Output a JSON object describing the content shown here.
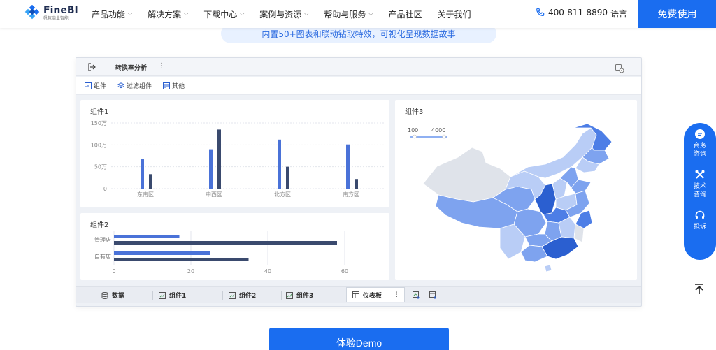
{
  "nav": {
    "logo_name": "FineBI",
    "logo_sub": "帆软商业智能",
    "menu": [
      {
        "label": "产品功能",
        "has_dropdown": true
      },
      {
        "label": "解决方案",
        "has_dropdown": true
      },
      {
        "label": "下载中心",
        "has_dropdown": true
      },
      {
        "label": "案例与资源",
        "has_dropdown": true
      },
      {
        "label": "帮助与服务",
        "has_dropdown": true
      },
      {
        "label": "产品社区",
        "has_dropdown": false
      },
      {
        "label": "关于我们",
        "has_dropdown": false
      }
    ],
    "phone": "400-811-8890",
    "language": "语言",
    "free_button": "免费使用"
  },
  "subtitle": "内置50+图表和联动钻取特效，可视化呈现数据故事",
  "dashboard": {
    "title": "转换率分析",
    "more": "⋮",
    "tools": [
      "组件",
      "过滤组件",
      "其他"
    ],
    "bottom_tabs": [
      {
        "label": "数据",
        "icon": "database-icon"
      },
      {
        "label": "组件1",
        "icon": "chart-icon"
      },
      {
        "label": "组件2",
        "icon": "chart-icon"
      },
      {
        "label": "组件3",
        "icon": "chart-icon"
      },
      {
        "label": "仪表板",
        "icon": "dashboard-icon",
        "active": true
      }
    ],
    "tab_more": "⋮",
    "chart_titles": [
      "组件1",
      "组件2",
      "组件3"
    ]
  },
  "chart_data": [
    {
      "type": "bar",
      "title": "组件1",
      "categories": [
        "东南区",
        "中西区",
        "北方区",
        "南方区"
      ],
      "y_ticks": [
        "0",
        "50万",
        "100万",
        "150万"
      ],
      "ylim": [
        0,
        150
      ],
      "series": [
        {
          "values": [
            67,
            90,
            112,
            101
          ]
        },
        {
          "values": [
            33,
            135,
            50,
            22
          ]
        }
      ],
      "colors": [
        "#4a72d8",
        "#3a4a6e"
      ]
    },
    {
      "type": "bar",
      "orientation": "horizontal",
      "title": "组件2",
      "categories": [
        "管理店",
        "自有店"
      ],
      "x_ticks": [
        "0",
        "20",
        "40",
        "60"
      ],
      "xlim": [
        0,
        60
      ],
      "series": [
        {
          "values": [
            17,
            25
          ]
        },
        {
          "values": [
            58,
            35
          ]
        }
      ],
      "colors": [
        "#4a72d8",
        "#3a4a6e"
      ]
    },
    {
      "type": "map",
      "title": "组件3",
      "legend_min": "100",
      "legend_max": "4000",
      "colors": [
        "#dfe3ea",
        "#b9cdf6",
        "#7ea3ef",
        "#4d7ee6",
        "#2b5fd0"
      ]
    }
  ],
  "float_panel": [
    "商务咨询",
    "技术咨询",
    "投诉"
  ],
  "cta": "体验Demo",
  "colors": {
    "brand": "#1a6df0"
  }
}
